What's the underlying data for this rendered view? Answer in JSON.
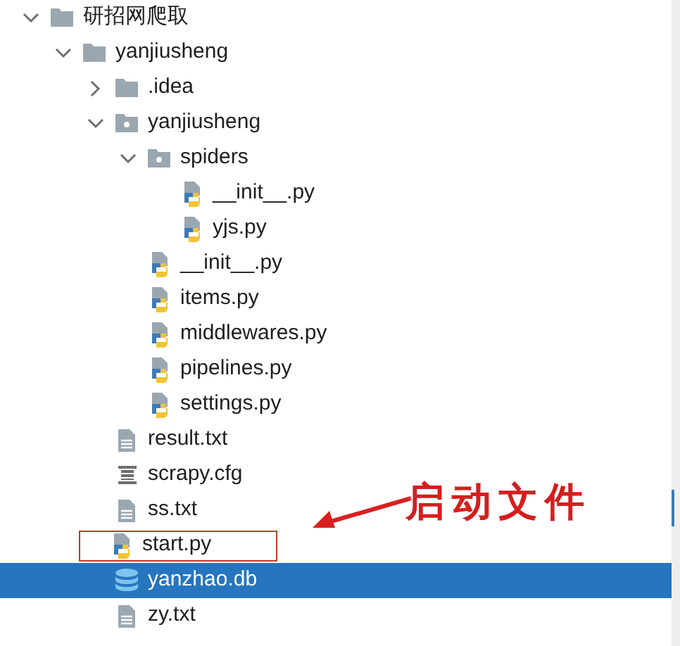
{
  "tree": [
    {
      "label": "研招网爬取",
      "kind": "folder",
      "expanded": true,
      "selected": false,
      "children": [
        {
          "label": "yanjiusheng",
          "kind": "folder",
          "expanded": true,
          "selected": false,
          "children": [
            {
              "label": ".idea",
              "kind": "folder",
              "expanded": false,
              "selected": false
            },
            {
              "label": "yanjiusheng",
              "kind": "package",
              "expanded": true,
              "selected": false,
              "children": [
                {
                  "label": "spiders",
                  "kind": "package",
                  "expanded": true,
                  "selected": false,
                  "children": [
                    {
                      "label": "__init__.py",
                      "kind": "python",
                      "selected": false
                    },
                    {
                      "label": "yjs.py",
                      "kind": "python",
                      "selected": false
                    }
                  ]
                },
                {
                  "label": "__init__.py",
                  "kind": "python",
                  "selected": false
                },
                {
                  "label": "items.py",
                  "kind": "python",
                  "selected": false
                },
                {
                  "label": "middlewares.py",
                  "kind": "python",
                  "selected": false
                },
                {
                  "label": "pipelines.py",
                  "kind": "python",
                  "selected": false
                },
                {
                  "label": "settings.py",
                  "kind": "python",
                  "selected": false
                }
              ]
            },
            {
              "label": "result.txt",
              "kind": "text",
              "selected": false
            },
            {
              "label": "scrapy.cfg",
              "kind": "config",
              "selected": false
            },
            {
              "label": "ss.txt",
              "kind": "text",
              "selected": false
            },
            {
              "label": "start.py",
              "kind": "python",
              "selected": false,
              "boxed": true
            },
            {
              "label": "yanzhao.db",
              "kind": "database",
              "selected": true
            },
            {
              "label": "zy.txt",
              "kind": "text",
              "selected": false
            }
          ]
        }
      ]
    }
  ],
  "annotation": {
    "text": "启动文件"
  }
}
